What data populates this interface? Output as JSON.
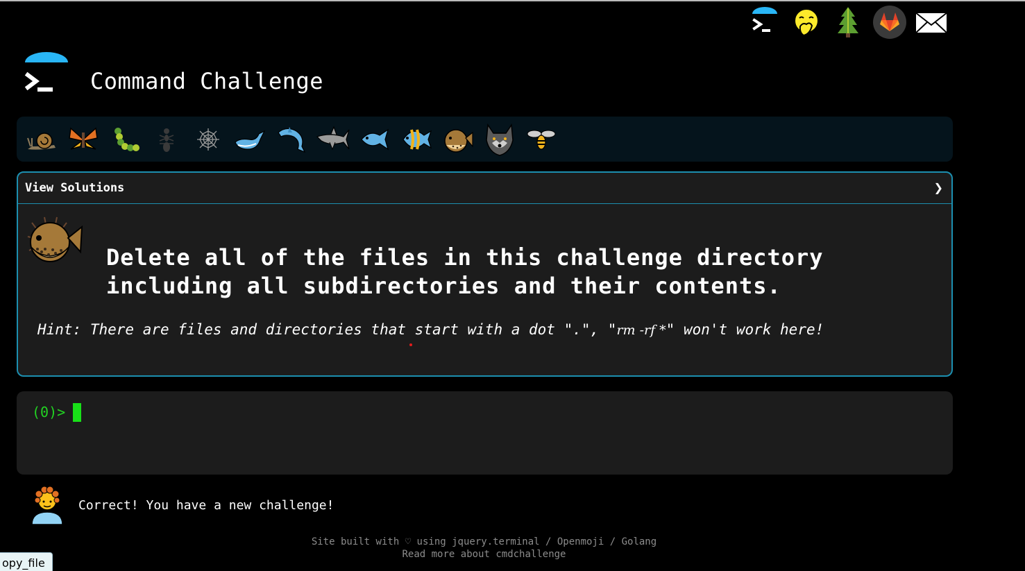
{
  "site": {
    "title": "Command Challenge"
  },
  "nav_icons": [
    "terminal-logo-icon",
    "face-with-hand-over-mouth-icon",
    "evergreen-tree-icon",
    "gitlab-icon",
    "envelope-icon"
  ],
  "levels": [
    "snail",
    "butterfly",
    "caterpillar",
    "ant",
    "spider-web",
    "whale",
    "dolphin",
    "shark",
    "fish",
    "tropical-fish",
    "blowfish",
    "wolf",
    "bee"
  ],
  "challenge": {
    "header_label": "View Solutions",
    "chevron": "❯",
    "task": "Delete all of the files in this challenge directory including all subdirectories and their contents.",
    "hint_prefix": "Hint: There are files and directories that start with a dot \".\", \"",
    "hint_code": "rm -rf *",
    "hint_suffix": "\" won't work here!"
  },
  "terminal": {
    "prompt": "(0)>"
  },
  "status": {
    "message": "Correct! You have a new challenge!"
  },
  "footer": {
    "line1_prefix": "Site built with ♡ using ",
    "link_jquery": "jquery.terminal",
    "sep1": " / ",
    "link_openmoji": "Openmoji",
    "sep2": " / ",
    "link_golang": "Golang",
    "line2_prefix": "Read more about ",
    "link_cmdchallenge": "cmdchallenge"
  },
  "tooltip": {
    "text": "opy_file"
  },
  "colors": {
    "accent": "#1c8fb0",
    "prompt_green": "#22d322",
    "panel_bg": "#1c1c1c",
    "level_bar_bg": "#05141c"
  }
}
